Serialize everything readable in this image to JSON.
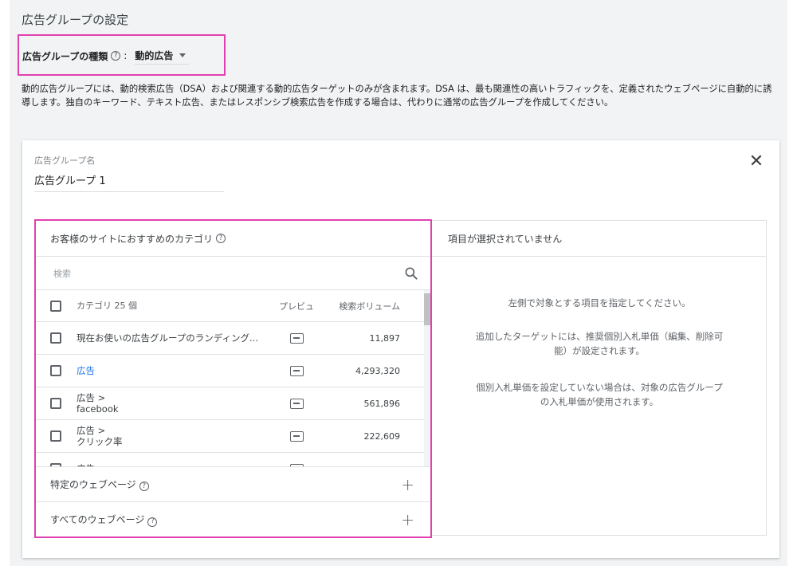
{
  "page": {
    "title": "広告グループの設定"
  },
  "ad_group_type": {
    "label": "広告グループの種類",
    "help": "?",
    "colon": ":",
    "value": "動的広告"
  },
  "description": "動的広告グループには、動的検索広告（DSA）および関連する動的広告ターゲットのみが含まれます。DSA は、最も関連性の高いトラフィックを、定義されたウェブページに自動的に誘導します。独自のキーワード、テキスト広告、またはレスポンシブ検索広告を作成する場合は、代わりに通常の広告グループを作成してください。",
  "card": {
    "name_label": "広告グループ名",
    "name_value": "広告グループ 1",
    "close": "✕"
  },
  "categories_panel": {
    "header": "お客様のサイトにおすすめのカテゴリ",
    "help": "?",
    "search_placeholder": "検索",
    "columns": {
      "name": "カテゴリ 25 個",
      "preview": "プレビュ",
      "volume": "検索ボリューム"
    },
    "rows": [
      {
        "name": "現在お使いの広告グループのランディング...",
        "volume": "11,897",
        "link": false
      },
      {
        "name": "広告",
        "volume": "4,293,320",
        "link": true
      },
      {
        "name": "広告 >\nfacebook",
        "volume": "561,896",
        "link": false
      },
      {
        "name": "広告 >\nクリック率",
        "volume": "222,609",
        "link": false
      },
      {
        "name": "広告 >",
        "volume": "",
        "link": false
      }
    ],
    "expanders": [
      {
        "label": "特定のウェブページ",
        "help": "?"
      },
      {
        "label": "すべてのウェブページ",
        "help": "?"
      }
    ]
  },
  "selection_panel": {
    "header": "項目が選択されていません",
    "message_1": "左側で対象とする項目を指定してください。",
    "message_2": "追加したターゲットには、推奨個別入札単価（編集、削除可能）が設定されます。",
    "message_3": "個別入札単価を設定していない場合は、対象の広告グループの入札単価が使用されます。"
  },
  "colors": {
    "highlight": "#e040b0",
    "link": "#1a73e8",
    "background": "#f1f3f4"
  }
}
